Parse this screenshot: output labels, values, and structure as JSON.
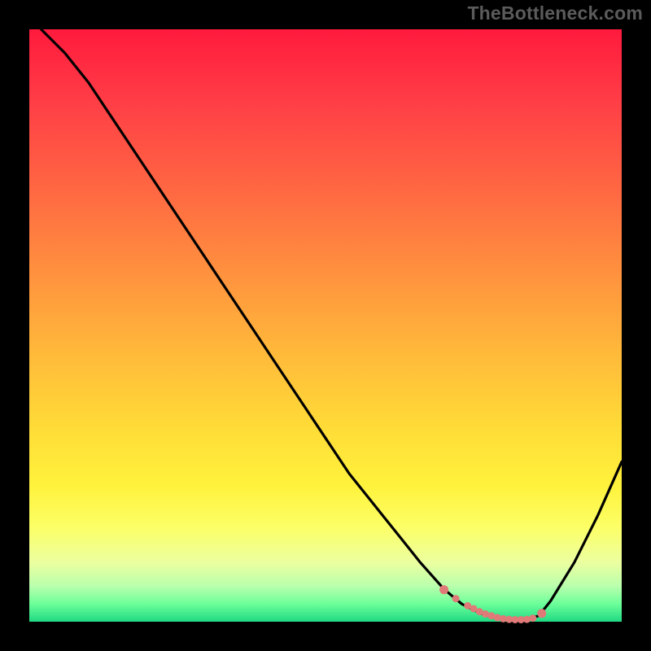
{
  "watermark": "TheBottleneck.com",
  "colors": {
    "background": "#000000",
    "curve": "#000000",
    "markers": "#e07a78",
    "watermark_text": "#5b5b5b"
  },
  "chart_data": {
    "type": "line",
    "title": "",
    "xlabel": "",
    "ylabel": "",
    "xlim": [
      0,
      100
    ],
    "ylim": [
      0,
      100
    ],
    "grid": false,
    "legend": false,
    "series": [
      {
        "name": "bottleneck-curve",
        "x": [
          2,
          6,
          10,
          14,
          18,
          22,
          26,
          30,
          34,
          38,
          42,
          46,
          50,
          54,
          58,
          62,
          66,
          70,
          73,
          76,
          78,
          80,
          82,
          84,
          86,
          88,
          92,
          96,
          100
        ],
        "y": [
          100,
          96,
          91,
          85,
          79,
          73,
          67,
          61,
          55,
          49,
          43,
          37,
          31,
          25,
          20,
          15,
          10,
          5.5,
          3,
          1.5,
          0.8,
          0.4,
          0.3,
          0.4,
          1.0,
          3.5,
          10,
          18,
          27
        ]
      }
    ],
    "markers": {
      "name": "near-minimum-dots",
      "x": [
        70,
        72,
        74,
        75,
        76,
        77,
        78,
        79,
        80,
        81,
        82,
        83,
        84,
        85,
        86.5
      ],
      "y": [
        5.4,
        3.9,
        2.7,
        2.2,
        1.7,
        1.3,
        1.0,
        0.7,
        0.5,
        0.4,
        0.35,
        0.35,
        0.4,
        0.6,
        1.4
      ]
    }
  }
}
